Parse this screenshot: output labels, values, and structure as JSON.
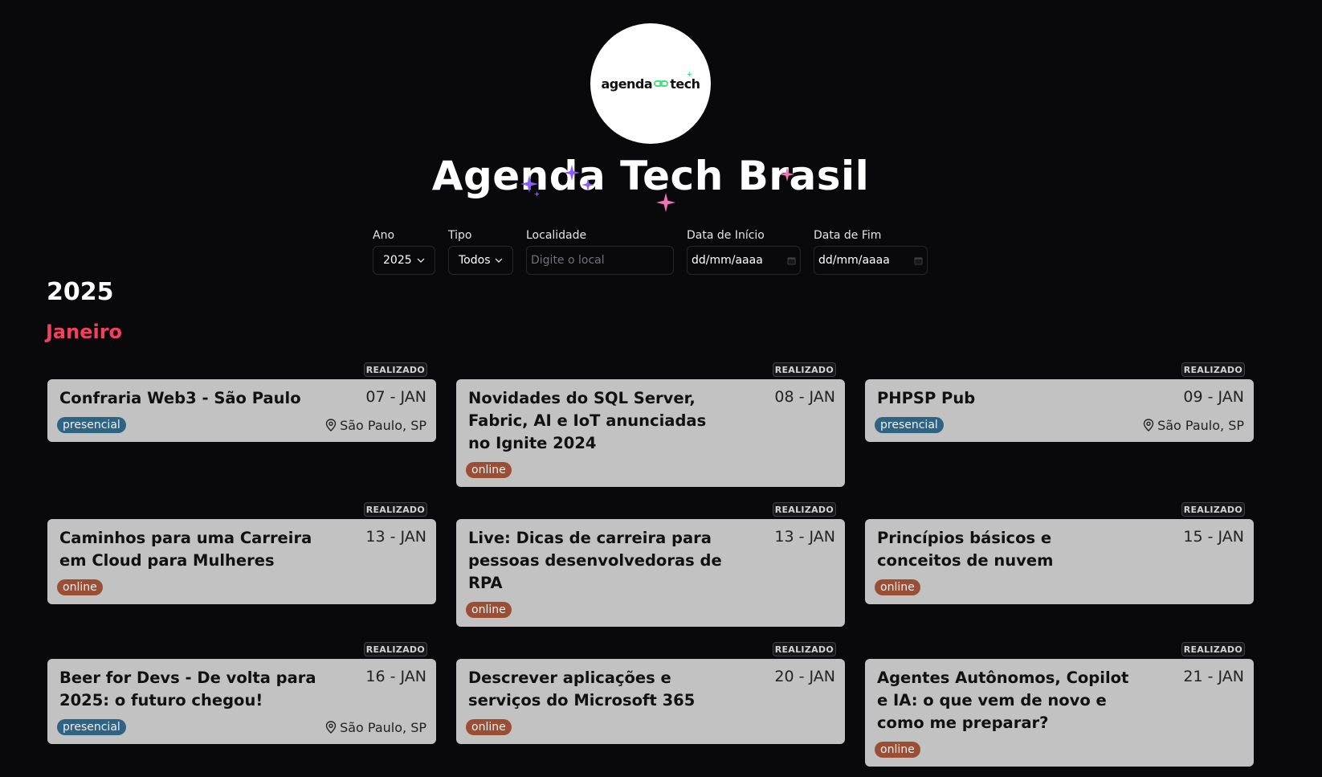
{
  "logo": {
    "part1": "agenda",
    "part2": "tech"
  },
  "title": "Agenda Tech Brasil",
  "colors": {
    "background": "#09090b",
    "accent_month": "#f43f5e",
    "card_bg": "#c2c2c2",
    "tag_presencial": "#2f6384",
    "tag_online": "#9a4f35",
    "sparkle_purple": "#8b5cf6",
    "sparkle_pink": "#f472b6"
  },
  "filters": {
    "ano": {
      "label": "Ano",
      "value": "2025"
    },
    "tipo": {
      "label": "Tipo",
      "value": "Todos"
    },
    "localidade": {
      "label": "Localidade",
      "placeholder": "Digite o local"
    },
    "data_inicio": {
      "label": "Data de Início",
      "value": "dd/mm/aaaa"
    },
    "data_fim": {
      "label": "Data de Fim",
      "value": "dd/mm/aaaa"
    }
  },
  "year": "2025",
  "month": "Janeiro",
  "status_label": "REALIZADO",
  "events": [
    {
      "title": "Confraria Web3 - São Paulo",
      "date": "07 - JAN",
      "type": "presencial",
      "location": "São Paulo, SP"
    },
    {
      "title": "Novidades do SQL Server, Fabric, AI e IoT anunciadas no Ignite 2024",
      "date": "08 - JAN",
      "type": "online",
      "location": ""
    },
    {
      "title": "PHPSP Pub",
      "date": "09 - JAN",
      "type": "presencial",
      "location": "São Paulo, SP"
    },
    {
      "title": "Caminhos para uma Carreira em Cloud para Mulheres",
      "date": "13 - JAN",
      "type": "online",
      "location": ""
    },
    {
      "title": "Live: Dicas de carreira para pessoas desenvolvedoras de RPA",
      "date": "13 - JAN",
      "type": "online",
      "location": ""
    },
    {
      "title": "Princípios básicos e conceitos de nuvem",
      "date": "15 - JAN",
      "type": "online",
      "location": ""
    },
    {
      "title": "Beer for Devs - De volta para 2025: o futuro chegou!",
      "date": "16 - JAN",
      "type": "presencial",
      "location": "São Paulo, SP"
    },
    {
      "title": "Descrever aplicações e serviços do Microsoft 365",
      "date": "20 - JAN",
      "type": "online",
      "location": ""
    },
    {
      "title": "Agentes Autônomos, Copilot e IA: o que vem de novo e como me preparar?",
      "date": "21 - JAN",
      "type": "online",
      "location": ""
    }
  ]
}
